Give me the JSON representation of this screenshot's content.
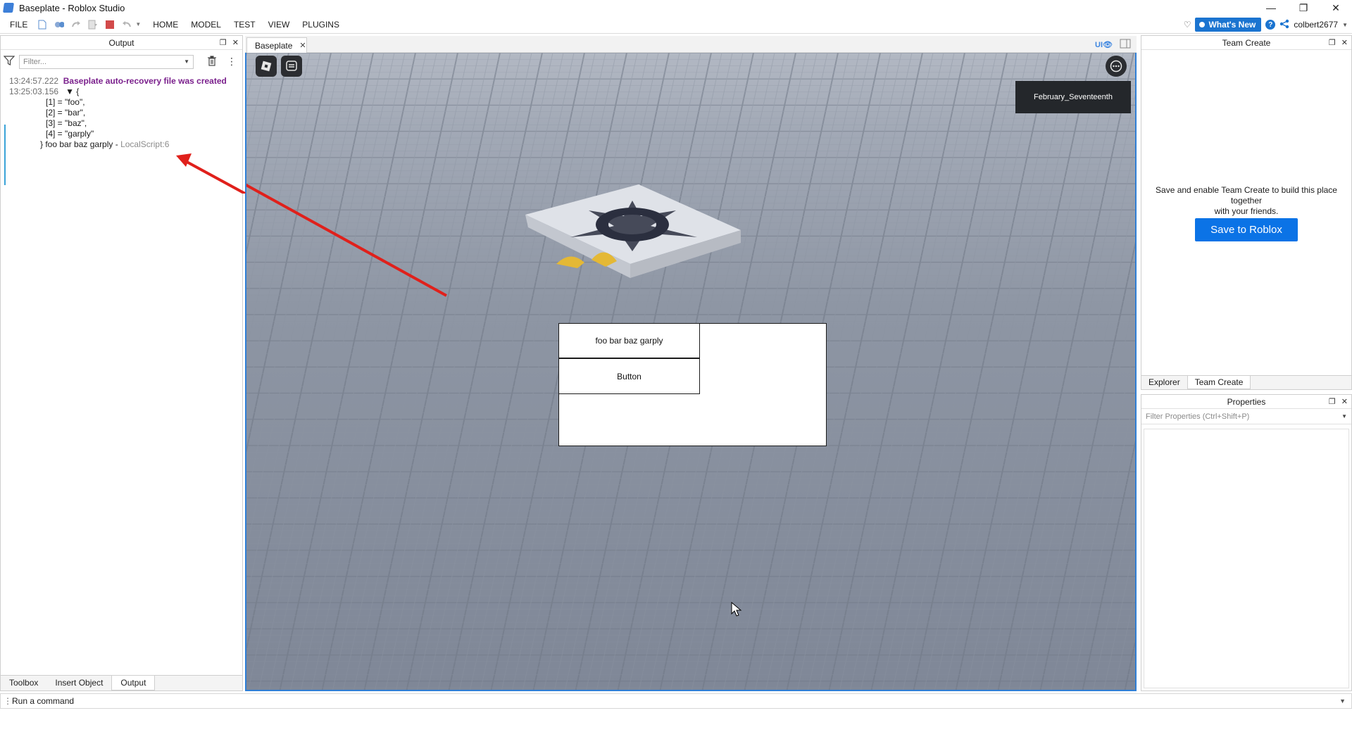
{
  "window": {
    "title": "Baseplate - Roblox Studio"
  },
  "menu": {
    "file": "FILE",
    "home": "HOME",
    "model": "MODEL",
    "test": "TEST",
    "view": "VIEW",
    "plugins": "PLUGINS"
  },
  "menubar_right": {
    "whats_new": "What's New",
    "username": "colbert2677"
  },
  "output": {
    "title": "Output",
    "filter_placeholder": "Filter...",
    "lines": {
      "l1_time": "13:24:57.222",
      "l1_msg": "Baseplate auto-recovery file was created",
      "l2_time": "13:25:03.156",
      "l2_msg": "▼  {",
      "l3": "[1] = \"foo\",",
      "l4": "[2] = \"bar\",",
      "l5": "[3] = \"baz\",",
      "l6": "[4] = \"garply\"",
      "l7_msg": "} foo bar baz garply - ",
      "l7_src": "LocalScript:6"
    },
    "tabs": [
      "Toolbox",
      "Insert Object",
      "Output"
    ]
  },
  "document_tab": {
    "label": "Baseplate"
  },
  "viewport": {
    "ui_toggle": "UI",
    "player_name": "February_Seventeenth",
    "gui_label": "foo bar baz garply",
    "gui_button": "Button"
  },
  "team_create": {
    "title": "Team Create",
    "message_line1": "Save and enable Team Create to build this place together",
    "message_line2": "with your friends.",
    "save_button": "Save to Roblox",
    "tabs": [
      "Explorer",
      "Team Create"
    ]
  },
  "properties": {
    "title": "Properties",
    "filter_placeholder": "Filter Properties (Ctrl+Shift+P)"
  },
  "command_bar": {
    "placeholder": "Run a command"
  },
  "colors": {
    "accent": "#2f7fd6",
    "save_button": "#0b73e6",
    "warning_text": "#7a1f8c",
    "arrow": "#e0201b"
  }
}
